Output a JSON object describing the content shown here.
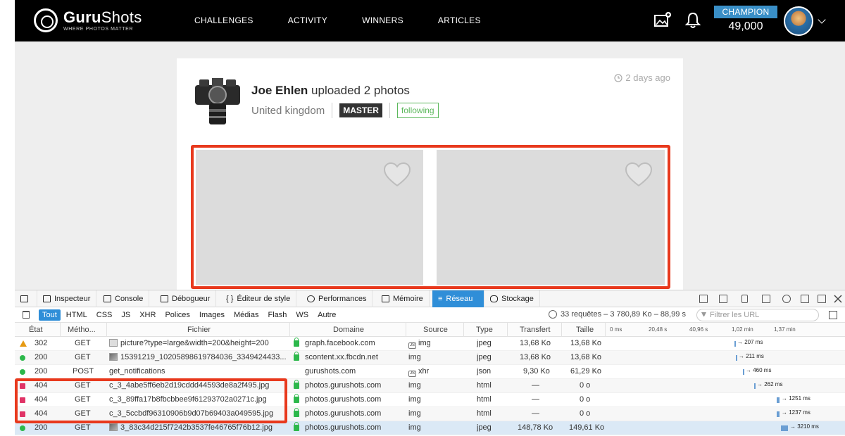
{
  "header": {
    "logo": {
      "name_bold": "Guru",
      "name_rest": "Shots",
      "tagline": "WHERE PHOTOS MATTER"
    },
    "nav": [
      "CHALLENGES",
      "ACTIVITY",
      "WINNERS",
      "ARTICLES"
    ],
    "champion_label": "CHAMPION",
    "points": "49,000",
    "accent_color": "#3a8fc7"
  },
  "post": {
    "user_name": "Joe Ehlen",
    "action": " uploaded 2 photos",
    "location": "United kingdom",
    "level_badge": "MASTER",
    "follow_status": "following",
    "time_ago": "2 days ago"
  },
  "devtools": {
    "tabs": [
      "Inspecteur",
      "Console",
      "Débogueur",
      "Éditeur de style",
      "Performances",
      "Mémoire",
      "Réseau",
      "Stockage"
    ],
    "active_tab": "Réseau",
    "filters": [
      "Tout",
      "HTML",
      "CSS",
      "JS",
      "XHR",
      "Polices",
      "Images",
      "Médias",
      "Flash",
      "WS",
      "Autre"
    ],
    "summary": "33 requêtes – 3 780,89 Ko – 88,99 s",
    "url_filter_placeholder": "Filtrer les URL",
    "columns": [
      "État",
      "Métho...",
      "Fichier",
      "Domaine",
      "Source",
      "Type",
      "Transfert",
      "Taille"
    ],
    "timeline_ticks": [
      "0 ms",
      "20,48 s",
      "40,96 s",
      "1,02 min",
      "1,37 min"
    ],
    "rows": [
      {
        "status": "302",
        "method": "GET",
        "file": "picture?type=large&width=200&height=200",
        "domain": "graph.facebook.com",
        "source": "img",
        "type": "jpeg",
        "transfer": "13,68 Ko",
        "size": "13,68 Ko",
        "timing": "→ 207 ms"
      },
      {
        "status": "200",
        "method": "GET",
        "file": "15391219_10205898619784036_3349424433...",
        "domain": "scontent.xx.fbcdn.net",
        "source": "img",
        "type": "jpeg",
        "transfer": "13,68 Ko",
        "size": "13,68 Ko",
        "timing": "→ 211 ms"
      },
      {
        "status": "200",
        "method": "POST",
        "file": "get_notifications",
        "domain": "gurushots.com",
        "source": "xhr",
        "type": "json",
        "transfer": "9,30 Ko",
        "size": "61,29 Ko",
        "timing": "→ 460 ms"
      },
      {
        "status": "404",
        "method": "GET",
        "file": "c_3_4abe5ff6eb2d19cddd44593de8a2f495.jpg",
        "domain": "photos.gurushots.com",
        "source": "img",
        "type": "html",
        "transfer": "—",
        "size": "0 o",
        "timing": "→ 262 ms"
      },
      {
        "status": "404",
        "method": "GET",
        "file": "c_3_89ffa17b8fbcbbee9f61293702a0271c.jpg",
        "domain": "photos.gurushots.com",
        "source": "img",
        "type": "html",
        "transfer": "—",
        "size": "0 o",
        "timing": "→ 1251 ms"
      },
      {
        "status": "404",
        "method": "GET",
        "file": "c_3_5ccbdf96310906b9d07b69403a049595.jpg",
        "domain": "photos.gurushots.com",
        "source": "img",
        "type": "html",
        "transfer": "—",
        "size": "0 o",
        "timing": "→ 1237 ms"
      },
      {
        "status": "200",
        "method": "GET",
        "file": "3_83c34d215f7242b3537fe46765f76b12.jpg",
        "domain": "photos.gurushots.com",
        "source": "img",
        "type": "jpeg",
        "transfer": "148,78 Ko",
        "size": "149,61 Ko",
        "timing": "→ 3210 ms"
      }
    ]
  }
}
